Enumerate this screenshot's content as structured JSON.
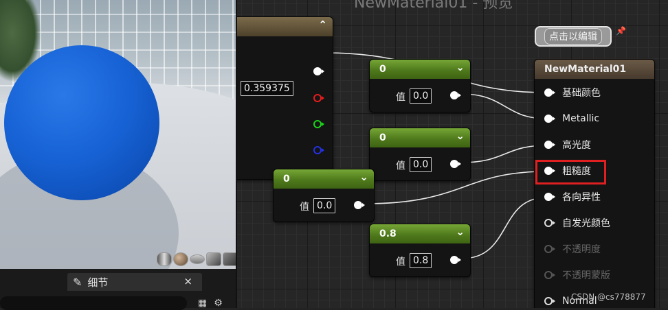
{
  "viewport": {
    "preview_shapes": [
      "cylinder",
      "sphere",
      "plane",
      "cube",
      "teapot"
    ]
  },
  "details": {
    "tab_label": "细节",
    "close_glyph": "×"
  },
  "graph": {
    "title": "NewMaterial01 - 预览"
  },
  "vector_node": {
    "value": "0.359375"
  },
  "constants": [
    {
      "header": "0",
      "label": "值",
      "value": "0.0"
    },
    {
      "header": "0",
      "label": "值",
      "value": "0.0"
    },
    {
      "header": "0",
      "label": "值",
      "value": "0.0"
    },
    {
      "header": "0.8",
      "label": "值",
      "value": "0.8"
    }
  ],
  "comment": {
    "text": "点击以编辑"
  },
  "material_node": {
    "title": "NewMaterial01",
    "pins": [
      {
        "label": "基础颜色",
        "connected": true,
        "enabled": true
      },
      {
        "label": "Metallic",
        "connected": true,
        "enabled": true
      },
      {
        "label": "高光度",
        "connected": true,
        "enabled": true
      },
      {
        "label": "粗糙度",
        "connected": true,
        "enabled": true
      },
      {
        "label": "各向异性",
        "connected": true,
        "enabled": true
      },
      {
        "label": "自发光颜色",
        "connected": false,
        "enabled": true
      },
      {
        "label": "不透明度",
        "connected": false,
        "enabled": false
      },
      {
        "label": "不透明蒙版",
        "connected": false,
        "enabled": false
      },
      {
        "label": "Normal",
        "connected": false,
        "enabled": true
      }
    ]
  },
  "watermark": "CSDN @cs778877",
  "colors": {
    "sphere": "#1763d6",
    "constant_header": "#5a8a22",
    "highlight": "#e02020"
  }
}
